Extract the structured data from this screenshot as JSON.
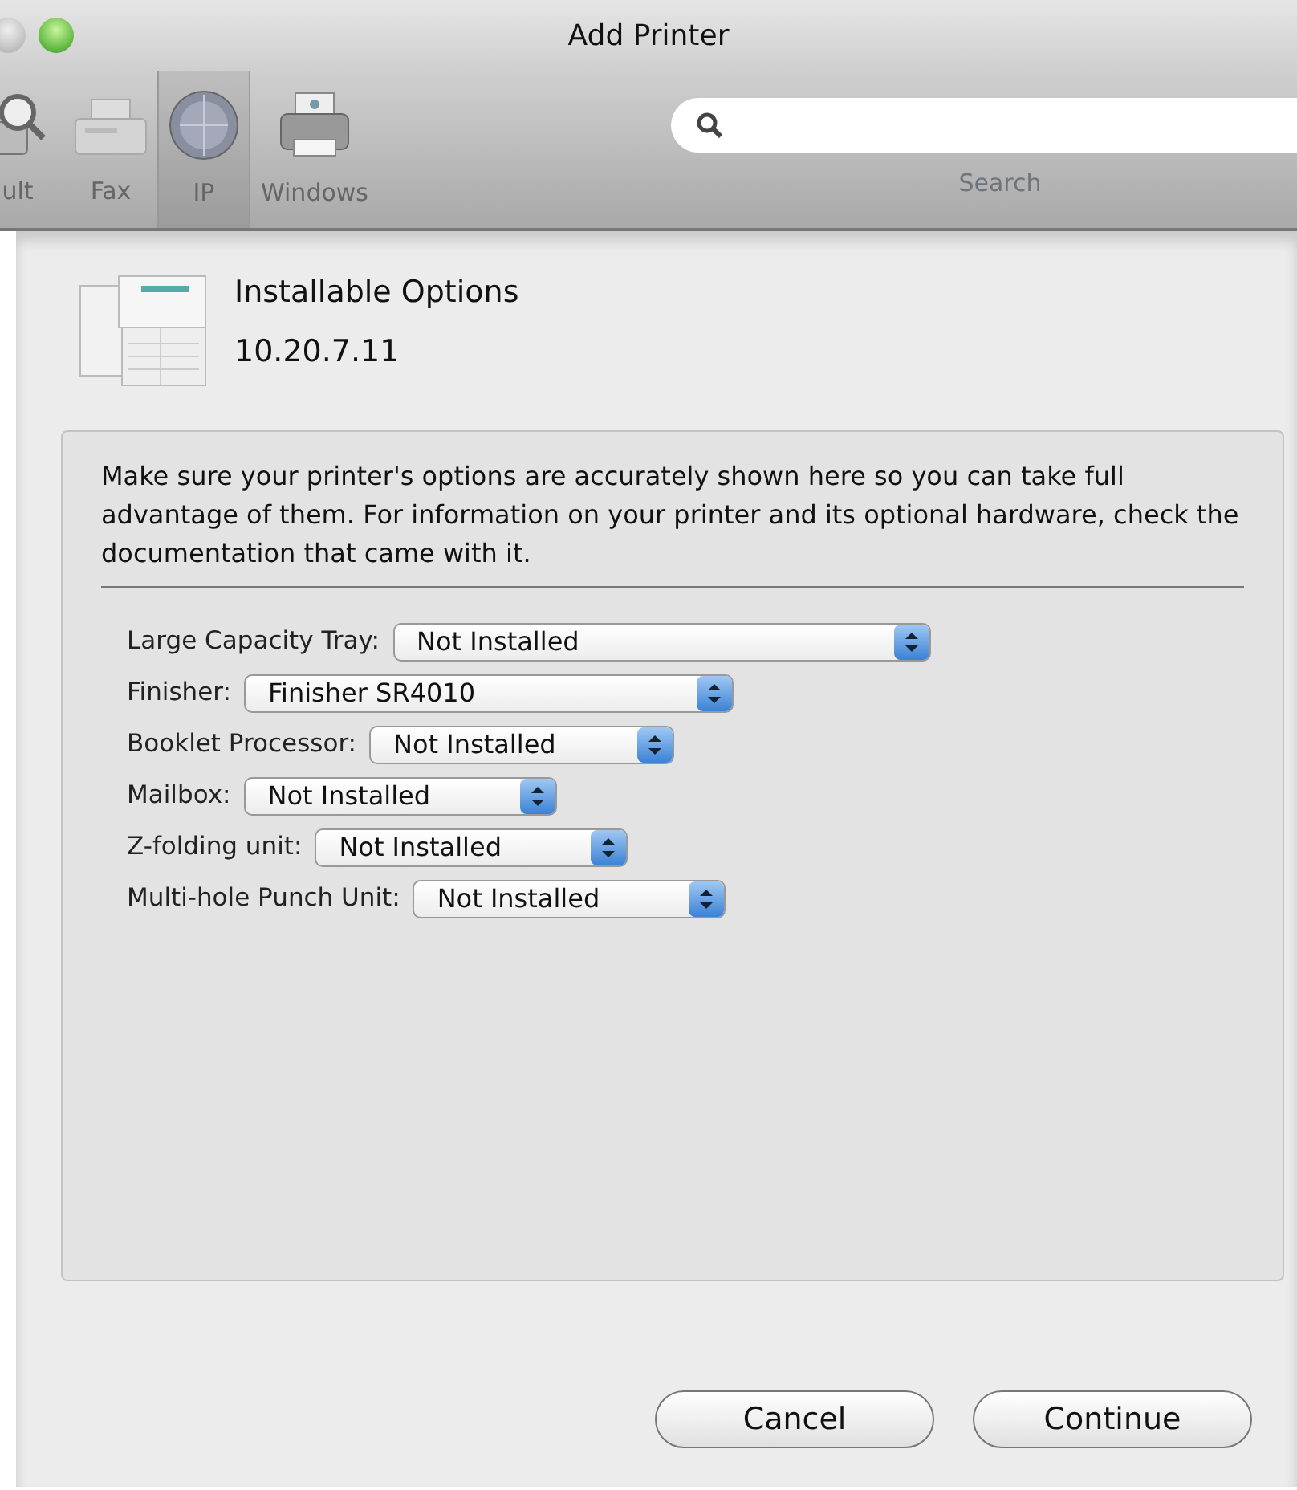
{
  "window": {
    "title": "Add Printer"
  },
  "toolbar": {
    "items": [
      {
        "label": "ult",
        "kind": "magnifier",
        "selected": false
      },
      {
        "label": "Fax",
        "kind": "fax",
        "selected": false
      },
      {
        "label": "IP",
        "kind": "globe",
        "selected": true
      },
      {
        "label": "Windows",
        "kind": "printer",
        "selected": false
      }
    ],
    "search": {
      "label": "Search"
    }
  },
  "sheet": {
    "title": "Installable Options",
    "subtitle": "10.20.7.11",
    "description": "Make sure your printer's options are accurately shown here so you can take full advantage of them.  For information on your printer and its optional hardware, check the documentation that came with it.",
    "options": [
      {
        "label": "Large Capacity Tray:",
        "value": "Not Installed"
      },
      {
        "label": "Finisher:",
        "value": "Finisher SR4010"
      },
      {
        "label": "Booklet Processor:",
        "value": "Not Installed"
      },
      {
        "label": "Mailbox:",
        "value": "Not Installed"
      },
      {
        "label": "Z-folding unit:",
        "value": "Not Installed"
      },
      {
        "label": "Multi-hole Punch Unit:",
        "value": "Not Installed"
      }
    ],
    "buttons": [
      "Cancel",
      "Continue"
    ]
  }
}
